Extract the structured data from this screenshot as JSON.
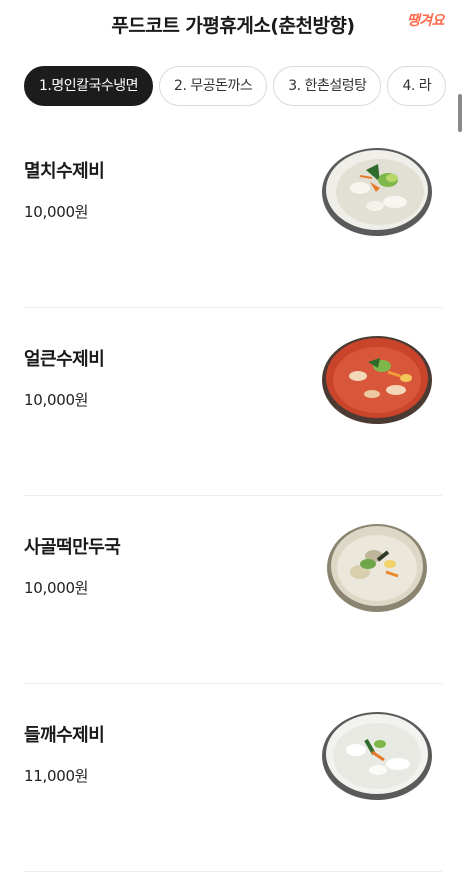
{
  "header": {
    "title": "푸드코트 가평휴게소(춘천방향)",
    "brand_logo": "땡겨요"
  },
  "tabs": [
    {
      "label": "1.명인칼국수냉면",
      "active": true
    },
    {
      "label": "2. 무공돈까스",
      "active": false
    },
    {
      "label": "3. 한촌설렁탕",
      "active": false
    },
    {
      "label": "4. 라",
      "active": false
    }
  ],
  "menu": [
    {
      "name": "멸치수제비",
      "price": "10,000원",
      "dish": "white-broth"
    },
    {
      "name": "얼큰수제비",
      "price": "10,000원",
      "dish": "spicy-broth"
    },
    {
      "name": "사골떡만두국",
      "price": "10,000원",
      "dish": "milky-broth"
    },
    {
      "name": "들깨수제비",
      "price": "11,000원",
      "dish": "perilla-broth"
    }
  ],
  "colors": {
    "accent": "#1c1c1c",
    "brand": "#ff6a4a"
  }
}
